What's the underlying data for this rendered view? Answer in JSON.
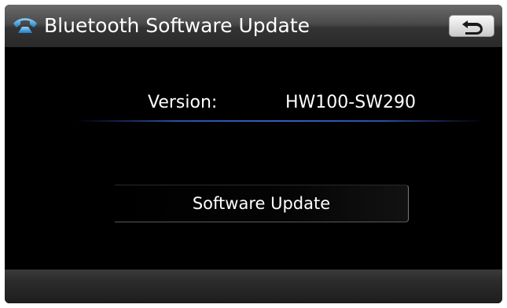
{
  "header": {
    "title": "Bluetooth Software Update",
    "icon": "bluetooth-phone-icon",
    "back_icon": "return-arrow-icon"
  },
  "version": {
    "label": "Version:",
    "value": "HW100-SW290"
  },
  "actions": {
    "software_update_label": "Software Update"
  },
  "colors": {
    "background": "#000000",
    "header": "#4a4a4a",
    "accent_divider": "#3a5cc0",
    "phone_icon": "#4aa8e6"
  }
}
